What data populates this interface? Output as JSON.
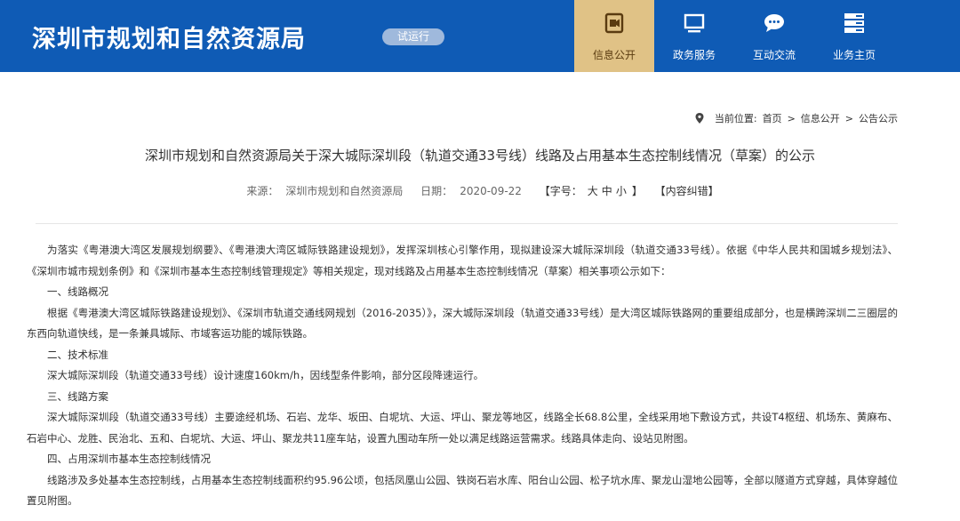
{
  "header": {
    "site_title": "深圳市规划和自然资源局",
    "beta_badge": "试运行",
    "nav": [
      {
        "label": "信息公开",
        "icon": "video-camera-icon",
        "active": true
      },
      {
        "label": "政务服务",
        "icon": "monitor-icon",
        "active": false
      },
      {
        "label": "互动交流",
        "icon": "chat-bubble-icon",
        "active": false
      },
      {
        "label": "业务主页",
        "icon": "server-icon",
        "active": false
      }
    ]
  },
  "breadcrumb": {
    "prefix": "当前位置:",
    "items": [
      "首页",
      "信息公开",
      "公告公示"
    ],
    "separator": ">"
  },
  "article": {
    "title": "深圳市规划和自然资源局关于深大城际深圳段（轨道交通33号线）线路及占用基本生态控制线情况（草案）的公示",
    "meta": {
      "source_label": "来源：",
      "source": "深圳市规划和自然资源局",
      "date_label": "日期：",
      "date": "2020-09-22",
      "font_size_label": "【字号：",
      "sizes": [
        "大",
        "中",
        "小"
      ],
      "font_size_close": "】",
      "correction": "【内容纠错】"
    },
    "paragraphs": [
      "为落实《粤港澳大湾区发展规划纲要》、《粤港澳大湾区城际铁路建设规划》，发挥深圳核心引擎作用，现拟建设深大城际深圳段（轨道交通33号线）。依据《中华人民共和国城乡规划法》、《深圳市城市规划条例》和《深圳市基本生态控制线管理规定》等相关规定，现对线路及占用基本生态控制线情况（草案）相关事项公示如下：",
      "一、线路概况",
      "根据《粤港澳大湾区城际铁路建设规划》、《深圳市轨道交通线网规划（2016-2035）》，深大城际深圳段（轨道交通33号线）是大湾区城际铁路网的重要组成部分，也是横跨深圳二三圈层的东西向轨道快线，是一条兼具城际、市域客运功能的城际铁路。",
      "二、技术标准",
      "深大城际深圳段（轨道交通33号线）设计速度160km/h，因线型条件影响，部分区段降速运行。",
      "三、线路方案",
      "深大城际深圳段（轨道交通33号线）主要途经机场、石岩、龙华、坂田、白坭坑、大运、坪山、聚龙等地区，线路全长68.8公里，全线采用地下敷设方式，共设T4枢纽、机场东、黄麻布、石岩中心、龙胜、民治北、五和、白坭坑、大运、坪山、聚龙共11座车站，设置九围动车所一处以满足线路运营需求。线路具体走向、设站见附图。",
      "四、占用深圳市基本生态控制线情况",
      "线路涉及多处基本生态控制线，占用基本生态控制线面积约95.96公顷，包括凤凰山公园、铁岗石岩水库、阳台山公园、松子坑水库、聚龙山湿地公园等，全部以隧道方式穿越，具体穿越位置见附图。"
    ]
  }
}
